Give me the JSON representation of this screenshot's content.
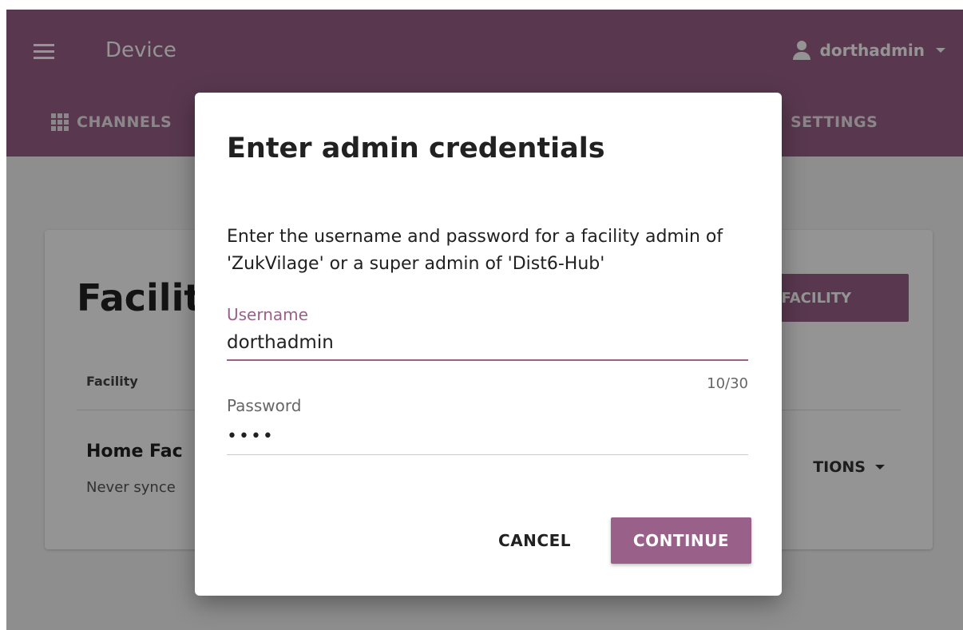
{
  "app": {
    "title": "Device",
    "user": "dorthadmin",
    "tabs": [
      {
        "label": "CHANNELS",
        "icon": "grid-icon"
      },
      {
        "label": "SETTINGS"
      }
    ]
  },
  "page": {
    "title": "Facilit",
    "import_button": "T FACILITY",
    "column_header": "Facility",
    "row": {
      "name": "Home Fac",
      "sync_status": "Never synce"
    },
    "options_label": "TIONS"
  },
  "dialog": {
    "title": "Enter admin credentials",
    "description": "Enter the username and password for a facility admin of 'ZukVilage' or a super admin of 'Dist6-Hub'",
    "username_label": "Username",
    "username_value": "dorthadmin",
    "char_counter": "10/30",
    "password_label": "Password",
    "password_mask": "••••",
    "cancel_label": "CANCEL",
    "continue_label": "CONTINUE"
  },
  "colors": {
    "brand": "#996189",
    "scrim": "rgba(0,0,0,0.42)"
  }
}
